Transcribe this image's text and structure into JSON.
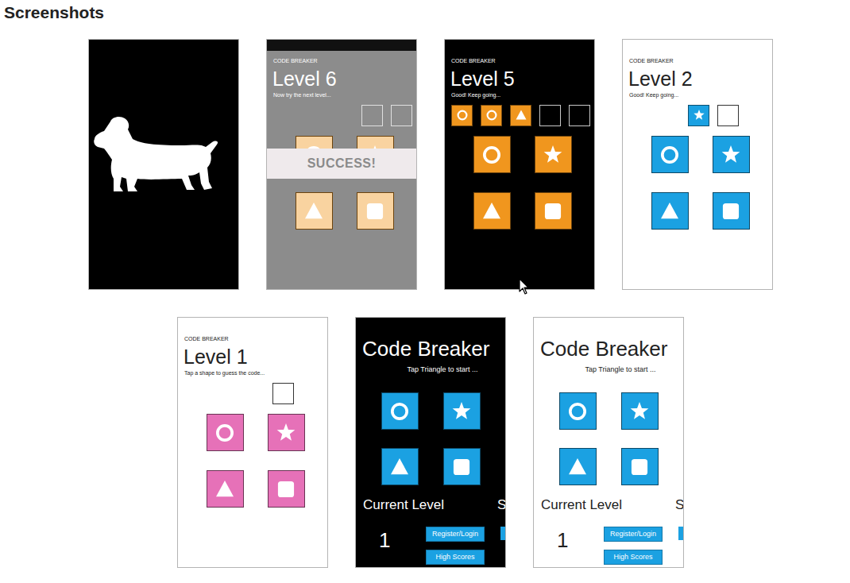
{
  "heading": "Screenshots",
  "phones": [
    {
      "kind": "splash",
      "background": "#000000"
    },
    {
      "kind": "success",
      "background": "#8c8c8c",
      "color": "#f0961e",
      "app_title": "CODE BREAKER",
      "level": "Level 6",
      "message": "Now try the next level...",
      "slots": [
        {
          "kind": "empty"
        },
        {
          "kind": "empty"
        }
      ],
      "banner": "SUCCESS!"
    },
    {
      "kind": "game",
      "background": "#000000",
      "color": "#f0961e",
      "app_title": "CODE BREAKER",
      "level": "Level 5",
      "message": "Good! Keep going...",
      "slots": [
        {
          "kind": "circle"
        },
        {
          "kind": "circle"
        },
        {
          "kind": "triangle"
        },
        {
          "kind": "empty"
        },
        {
          "kind": "empty"
        }
      ]
    },
    {
      "kind": "game",
      "background": "#ffffff",
      "color": "#1ba1e2",
      "app_title": "CODE BREAKER",
      "level": "Level 2",
      "message": "Good! Keep going...",
      "slots": [
        {
          "kind": "star"
        },
        {
          "kind": "empty"
        }
      ]
    },
    {
      "kind": "game",
      "background": "#ffffff",
      "color": "#e671b8",
      "app_title": "CODE BREAKER",
      "level": "Level 1",
      "message": "Tap a shape to guess the code...",
      "slots": [
        {
          "kind": "empty"
        }
      ]
    },
    {
      "kind": "menu",
      "background": "#000000",
      "color": "#1ba1e2",
      "title": "Code Breaker",
      "hint": "Tap Triangle to start ...",
      "level_label": "Current Level",
      "score_label": "S",
      "current_level": "1",
      "buttons": [
        "Register/Login",
        "High Scores"
      ]
    },
    {
      "kind": "menu",
      "background": "#ffffff",
      "color": "#1ba1e2",
      "title": "Code Breaker",
      "hint": "Tap Triangle to start ...",
      "level_label": "Current Level",
      "score_label": "S",
      "current_level": "1",
      "buttons": [
        "Register/Login",
        "High Scores"
      ]
    }
  ]
}
